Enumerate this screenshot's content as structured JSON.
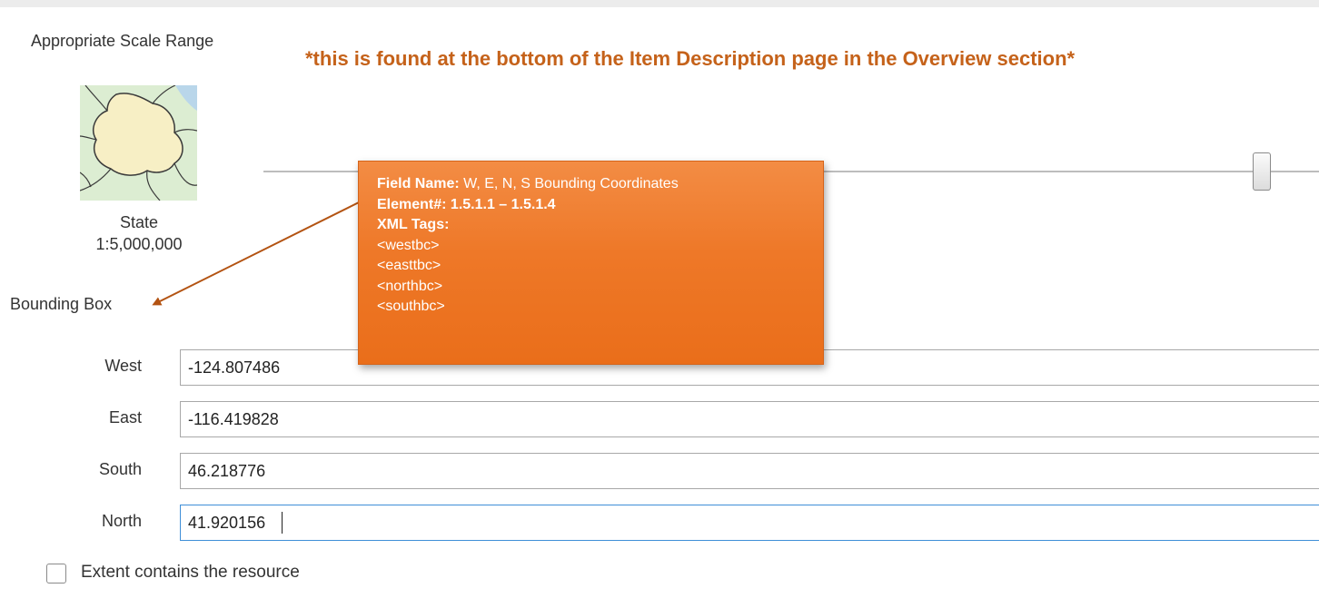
{
  "scale_range": {
    "title": "Appropriate Scale Range",
    "map_thumbnail_icon": "state-map-icon",
    "scale_name": "State",
    "scale_value": "1:5,000,000"
  },
  "annotation_note": "*this is found at the bottom of the Item Description page in the Overview section*",
  "callout": {
    "field_name_label": "Field Name:",
    "field_name_value": " W, E, N, S Bounding Coordinates",
    "element_label": "Element#: 1.5.1.1 – 1.5.1.4",
    "xml_tags_label": "XML Tags:",
    "tags": [
      "<westbc>",
      "<easttbc>",
      "<northbc>",
      "<southbc>"
    ]
  },
  "bounding_box": {
    "title": "Bounding Box",
    "fields": [
      {
        "label": "West",
        "value": "-124.807486"
      },
      {
        "label": "East",
        "value": "-116.419828"
      },
      {
        "label": "South",
        "value": "46.218776"
      },
      {
        "label": "North",
        "value": "41.920156"
      }
    ]
  },
  "extent_checkbox": {
    "label": "Extent contains the resource",
    "checked": false
  },
  "colors": {
    "callout_orange": "#ee7828",
    "note_orange": "#c5621a",
    "focus_blue": "#3f8fd8",
    "map_land": "#f7efc5",
    "map_neighbor": "#dcedd2",
    "map_water": "#b9d6ea"
  }
}
